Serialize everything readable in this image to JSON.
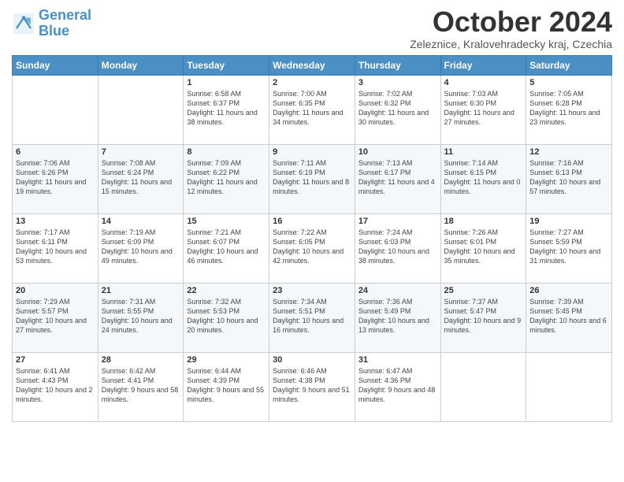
{
  "header": {
    "logo_general": "General",
    "logo_blue": "Blue",
    "month_title": "October 2024",
    "location": "Zeleznice, Kralovehradecky kraj, Czechia"
  },
  "weekdays": [
    "Sunday",
    "Monday",
    "Tuesday",
    "Wednesday",
    "Thursday",
    "Friday",
    "Saturday"
  ],
  "weeks": [
    [
      {
        "day": "",
        "info": ""
      },
      {
        "day": "",
        "info": ""
      },
      {
        "day": "1",
        "info": "Sunrise: 6:58 AM\nSunset: 6:37 PM\nDaylight: 11 hours and 38 minutes."
      },
      {
        "day": "2",
        "info": "Sunrise: 7:00 AM\nSunset: 6:35 PM\nDaylight: 11 hours and 34 minutes."
      },
      {
        "day": "3",
        "info": "Sunrise: 7:02 AM\nSunset: 6:32 PM\nDaylight: 11 hours and 30 minutes."
      },
      {
        "day": "4",
        "info": "Sunrise: 7:03 AM\nSunset: 6:30 PM\nDaylight: 11 hours and 27 minutes."
      },
      {
        "day": "5",
        "info": "Sunrise: 7:05 AM\nSunset: 6:28 PM\nDaylight: 11 hours and 23 minutes."
      }
    ],
    [
      {
        "day": "6",
        "info": "Sunrise: 7:06 AM\nSunset: 6:26 PM\nDaylight: 11 hours and 19 minutes."
      },
      {
        "day": "7",
        "info": "Sunrise: 7:08 AM\nSunset: 6:24 PM\nDaylight: 11 hours and 15 minutes."
      },
      {
        "day": "8",
        "info": "Sunrise: 7:09 AM\nSunset: 6:22 PM\nDaylight: 11 hours and 12 minutes."
      },
      {
        "day": "9",
        "info": "Sunrise: 7:11 AM\nSunset: 6:19 PM\nDaylight: 11 hours and 8 minutes."
      },
      {
        "day": "10",
        "info": "Sunrise: 7:13 AM\nSunset: 6:17 PM\nDaylight: 11 hours and 4 minutes."
      },
      {
        "day": "11",
        "info": "Sunrise: 7:14 AM\nSunset: 6:15 PM\nDaylight: 11 hours and 0 minutes."
      },
      {
        "day": "12",
        "info": "Sunrise: 7:16 AM\nSunset: 6:13 PM\nDaylight: 10 hours and 57 minutes."
      }
    ],
    [
      {
        "day": "13",
        "info": "Sunrise: 7:17 AM\nSunset: 6:11 PM\nDaylight: 10 hours and 53 minutes."
      },
      {
        "day": "14",
        "info": "Sunrise: 7:19 AM\nSunset: 6:09 PM\nDaylight: 10 hours and 49 minutes."
      },
      {
        "day": "15",
        "info": "Sunrise: 7:21 AM\nSunset: 6:07 PM\nDaylight: 10 hours and 46 minutes."
      },
      {
        "day": "16",
        "info": "Sunrise: 7:22 AM\nSunset: 6:05 PM\nDaylight: 10 hours and 42 minutes."
      },
      {
        "day": "17",
        "info": "Sunrise: 7:24 AM\nSunset: 6:03 PM\nDaylight: 10 hours and 38 minutes."
      },
      {
        "day": "18",
        "info": "Sunrise: 7:26 AM\nSunset: 6:01 PM\nDaylight: 10 hours and 35 minutes."
      },
      {
        "day": "19",
        "info": "Sunrise: 7:27 AM\nSunset: 5:59 PM\nDaylight: 10 hours and 31 minutes."
      }
    ],
    [
      {
        "day": "20",
        "info": "Sunrise: 7:29 AM\nSunset: 5:57 PM\nDaylight: 10 hours and 27 minutes."
      },
      {
        "day": "21",
        "info": "Sunrise: 7:31 AM\nSunset: 5:55 PM\nDaylight: 10 hours and 24 minutes."
      },
      {
        "day": "22",
        "info": "Sunrise: 7:32 AM\nSunset: 5:53 PM\nDaylight: 10 hours and 20 minutes."
      },
      {
        "day": "23",
        "info": "Sunrise: 7:34 AM\nSunset: 5:51 PM\nDaylight: 10 hours and 16 minutes."
      },
      {
        "day": "24",
        "info": "Sunrise: 7:36 AM\nSunset: 5:49 PM\nDaylight: 10 hours and 13 minutes."
      },
      {
        "day": "25",
        "info": "Sunrise: 7:37 AM\nSunset: 5:47 PM\nDaylight: 10 hours and 9 minutes."
      },
      {
        "day": "26",
        "info": "Sunrise: 7:39 AM\nSunset: 5:45 PM\nDaylight: 10 hours and 6 minutes."
      }
    ],
    [
      {
        "day": "27",
        "info": "Sunrise: 6:41 AM\nSunset: 4:43 PM\nDaylight: 10 hours and 2 minutes."
      },
      {
        "day": "28",
        "info": "Sunrise: 6:42 AM\nSunset: 4:41 PM\nDaylight: 9 hours and 58 minutes."
      },
      {
        "day": "29",
        "info": "Sunrise: 6:44 AM\nSunset: 4:39 PM\nDaylight: 9 hours and 55 minutes."
      },
      {
        "day": "30",
        "info": "Sunrise: 6:46 AM\nSunset: 4:38 PM\nDaylight: 9 hours and 51 minutes."
      },
      {
        "day": "31",
        "info": "Sunrise: 6:47 AM\nSunset: 4:36 PM\nDaylight: 9 hours and 48 minutes."
      },
      {
        "day": "",
        "info": ""
      },
      {
        "day": "",
        "info": ""
      }
    ]
  ]
}
